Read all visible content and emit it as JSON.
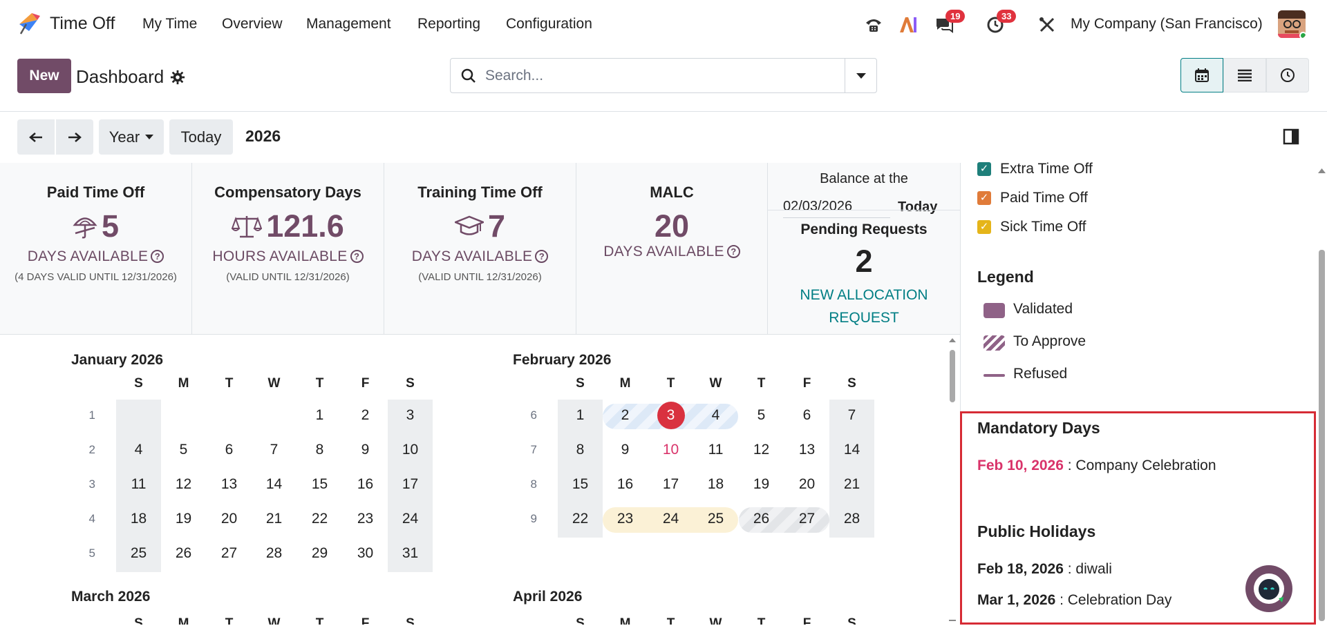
{
  "app": {
    "name": "Time Off"
  },
  "menu": [
    "My Time",
    "Overview",
    "Management",
    "Reporting",
    "Configuration"
  ],
  "systray": {
    "messages_badge": "19",
    "activities_badge": "33",
    "company": "My Company (San Francisco)"
  },
  "control": {
    "new_label": "New",
    "title": "Dashboard",
    "search_placeholder": "Search..."
  },
  "nav": {
    "scale_label": "Year",
    "today_label": "Today",
    "current": "2026"
  },
  "summary": [
    {
      "title": "Paid Time Off",
      "value": "5",
      "unit": "DAYS AVAILABLE",
      "note": "(4 DAYS VALID UNTIL 12/31/2026)",
      "icon": "umbrella-icon"
    },
    {
      "title": "Compensatory Days",
      "value": "121.6",
      "unit": "HOURS AVAILABLE",
      "note": "(VALID UNTIL 12/31/2026)",
      "icon": "scale-icon"
    },
    {
      "title": "Training Time Off",
      "value": "7",
      "unit": "DAYS AVAILABLE",
      "note": "(VALID UNTIL 12/31/2026)",
      "icon": "graduation-cap-icon"
    },
    {
      "title": "MALC",
      "value": "20",
      "unit": "DAYS AVAILABLE",
      "note": "",
      "icon": ""
    }
  ],
  "balance": {
    "label": "Balance at the",
    "date": "02/03/2026",
    "today": "Today",
    "pending_title": "Pending Requests",
    "pending_count": "2",
    "allocation_line1": "NEW ALLOCATION",
    "allocation_line2": "REQUEST"
  },
  "calendar": {
    "day_heads": [
      "S",
      "M",
      "T",
      "W",
      "T",
      "F",
      "S"
    ],
    "months": [
      {
        "title": "January 2026",
        "weeks": [
          {
            "wk": "1",
            "days": [
              "",
              "",
              "",
              "",
              "1",
              "2",
              "3"
            ]
          },
          {
            "wk": "2",
            "days": [
              "4",
              "5",
              "6",
              "7",
              "8",
              "9",
              "10"
            ]
          },
          {
            "wk": "3",
            "days": [
              "11",
              "12",
              "13",
              "14",
              "15",
              "16",
              "17"
            ]
          },
          {
            "wk": "4",
            "days": [
              "18",
              "19",
              "20",
              "21",
              "22",
              "23",
              "24"
            ]
          },
          {
            "wk": "5",
            "days": [
              "25",
              "26",
              "27",
              "28",
              "29",
              "30",
              "31"
            ]
          }
        ]
      },
      {
        "title": "February 2026",
        "weeks": [
          {
            "wk": "6",
            "days": [
              "1",
              "2",
              "3",
              "4",
              "5",
              "6",
              "7"
            ]
          },
          {
            "wk": "7",
            "days": [
              "8",
              "9",
              "10",
              "11",
              "12",
              "13",
              "14"
            ]
          },
          {
            "wk": "8",
            "days": [
              "15",
              "16",
              "17",
              "18",
              "19",
              "20",
              "21"
            ]
          },
          {
            "wk": "9",
            "days": [
              "22",
              "23",
              "24",
              "25",
              "26",
              "27",
              "28"
            ]
          }
        ]
      },
      {
        "title": "March 2026",
        "weeks": []
      },
      {
        "title": "April 2026",
        "weeks": []
      }
    ]
  },
  "sidebar": {
    "types": [
      {
        "label": "Extra Time Off",
        "color": "#1e7f7a"
      },
      {
        "label": "Paid Time Off",
        "color": "#e07b39"
      },
      {
        "label": "Sick Time Off",
        "color": "#e5b51a"
      }
    ],
    "legend_title": "Legend",
    "legend": [
      {
        "label": "Validated",
        "kind": "validated"
      },
      {
        "label": "To Approve",
        "kind": "to-approve"
      },
      {
        "label": "Refused",
        "kind": "refused"
      }
    ],
    "mandatory_title": "Mandatory Days",
    "mandatory": [
      {
        "date": "Feb 10, 2026",
        "name": ": Company Celebration"
      }
    ],
    "holidays_title": "Public Holidays",
    "holidays": [
      {
        "date": "Feb 18, 2026",
        "name": ": diwali"
      },
      {
        "date": "Mar 1, 2026",
        "name": ": Celebration Day"
      }
    ]
  },
  "colors": {
    "brand": "#714b67",
    "accent": "#017e84",
    "danger": "#d9313f",
    "mandatory": "#d9336a"
  }
}
